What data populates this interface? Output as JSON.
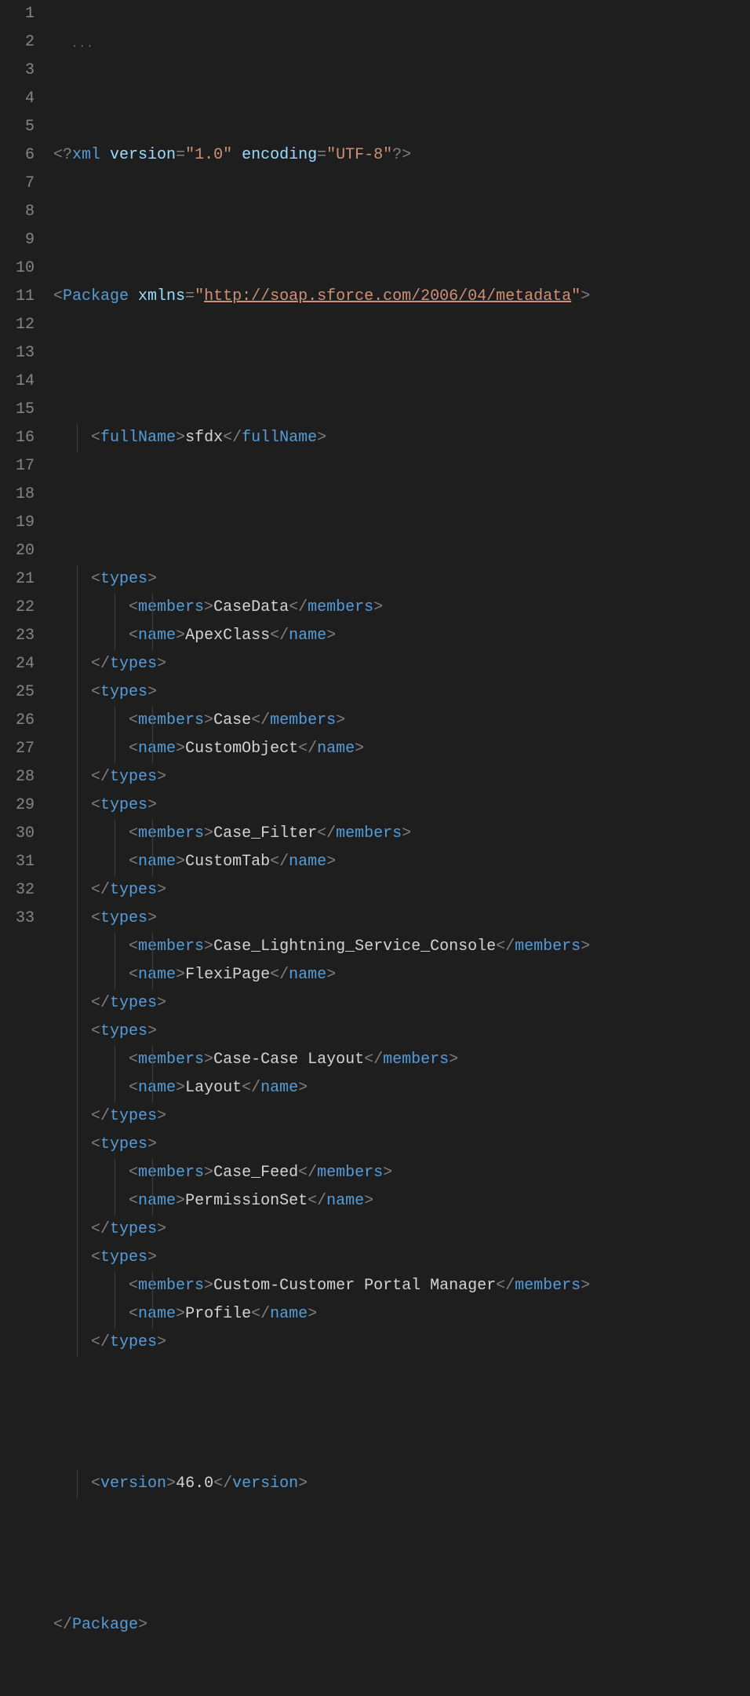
{
  "lineNumbers": [
    "1",
    "2",
    "3",
    "4",
    "5",
    "6",
    "7",
    "8",
    "9",
    "10",
    "11",
    "12",
    "13",
    "14",
    "15",
    "16",
    "17",
    "18",
    "19",
    "20",
    "21",
    "22",
    "23",
    "24",
    "25",
    "26",
    "27",
    "28",
    "29",
    "30",
    "31",
    "32",
    "33"
  ],
  "collapseDots": "···",
  "xmlDecl": {
    "open": "<?",
    "name": "xml",
    "versionAttr": "version",
    "versionVal": "\"1.0\"",
    "encodingAttr": "encoding",
    "encodingVal": "\"UTF-8\"",
    "close": "?>"
  },
  "packageTag": {
    "name": "Package",
    "xmlnsAttr": "xmlns",
    "xmlnsVal": "http://soap.sforce.com/2006/04/metadata"
  },
  "fullName": {
    "tag": "fullName",
    "value": "sfdx"
  },
  "types": [
    {
      "members": "CaseData",
      "name": "ApexClass"
    },
    {
      "members": "Case",
      "name": "CustomObject"
    },
    {
      "members": "Case_Filter",
      "name": "CustomTab"
    },
    {
      "members": "Case_Lightning_Service_Console",
      "name": "FlexiPage"
    },
    {
      "members": "Case-Case Layout",
      "name": "Layout"
    },
    {
      "members": "Case_Feed",
      "name": "PermissionSet"
    },
    {
      "members": "Custom-Customer Portal Manager",
      "name": "Profile"
    }
  ],
  "typesTag": "types",
  "membersTag": "members",
  "nameTag": "name",
  "versionTag": "version",
  "versionValue": "46.0",
  "sym": {
    "lt": "<",
    "gt": ">",
    "ltSlash": "</",
    "eq": "=",
    "q": "\""
  }
}
